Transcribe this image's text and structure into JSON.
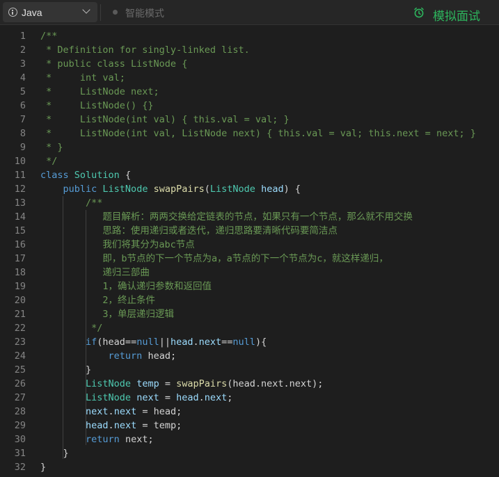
{
  "toolbar": {
    "language": "Java",
    "mode_label": "智能模式",
    "mock_interview_label": "模拟面试",
    "accent_color": "#2db55d"
  },
  "editor": {
    "lines": [
      {
        "n": "1",
        "segs": [
          {
            "t": "/**",
            "c": "cm"
          }
        ]
      },
      {
        "n": "2",
        "segs": [
          {
            "t": " * Definition for singly-linked list.",
            "c": "cm"
          }
        ]
      },
      {
        "n": "3",
        "segs": [
          {
            "t": " * public class ListNode {",
            "c": "cm"
          }
        ]
      },
      {
        "n": "4",
        "segs": [
          {
            "t": " *     int val;",
            "c": "cm"
          }
        ]
      },
      {
        "n": "5",
        "segs": [
          {
            "t": " *     ListNode next;",
            "c": "cm"
          }
        ]
      },
      {
        "n": "6",
        "segs": [
          {
            "t": " *     ListNode() {}",
            "c": "cm"
          }
        ]
      },
      {
        "n": "7",
        "segs": [
          {
            "t": " *     ListNode(int val) { this.val = val; }",
            "c": "cm"
          }
        ]
      },
      {
        "n": "8",
        "segs": [
          {
            "t": " *     ListNode(int val, ListNode next) { this.val = val; this.next = next; }",
            "c": "cm"
          }
        ]
      },
      {
        "n": "9",
        "segs": [
          {
            "t": " * }",
            "c": "cm"
          }
        ]
      },
      {
        "n": "10",
        "segs": [
          {
            "t": " */",
            "c": "cm"
          }
        ]
      },
      {
        "n": "11",
        "segs": [
          {
            "t": "class ",
            "c": "kw"
          },
          {
            "t": "Solution",
            "c": "tp"
          },
          {
            "t": " {",
            "c": "pl"
          }
        ]
      },
      {
        "n": "12",
        "segs": [
          {
            "t": "    ",
            "c": "pl"
          },
          {
            "t": "public ",
            "c": "kw"
          },
          {
            "t": "ListNode",
            "c": "tp"
          },
          {
            "t": " ",
            "c": "pl"
          },
          {
            "t": "swapPairs",
            "c": "fn"
          },
          {
            "t": "(",
            "c": "pl"
          },
          {
            "t": "ListNode",
            "c": "tp"
          },
          {
            "t": " ",
            "c": "pl"
          },
          {
            "t": "head",
            "c": "vr"
          },
          {
            "t": ") {",
            "c": "pl"
          }
        ]
      },
      {
        "n": "13",
        "segs": [
          {
            "t": "        /**",
            "c": "cm"
          }
        ]
      },
      {
        "n": "14",
        "segs": [
          {
            "t": "           题目解析：两两交换给定链表的节点，如果只有一个节点，那么就不用交换",
            "c": "cm"
          }
        ]
      },
      {
        "n": "15",
        "segs": [
          {
            "t": "           思路：使用递归或者迭代，递归思路要清晰代码要简洁点",
            "c": "cm"
          }
        ]
      },
      {
        "n": "16",
        "segs": [
          {
            "t": "           我们将其分为abc节点",
            "c": "cm"
          }
        ]
      },
      {
        "n": "17",
        "segs": [
          {
            "t": "           即，b节点的下一个节点为a，a节点的下一个节点为c，就这样递归，",
            "c": "cm"
          }
        ]
      },
      {
        "n": "18",
        "segs": [
          {
            "t": "           递归三部曲",
            "c": "cm"
          }
        ]
      },
      {
        "n": "19",
        "segs": [
          {
            "t": "           1，确认递归参数和返回值",
            "c": "cm"
          }
        ]
      },
      {
        "n": "20",
        "segs": [
          {
            "t": "           2，终止条件",
            "c": "cm"
          }
        ]
      },
      {
        "n": "21",
        "segs": [
          {
            "t": "           3，单层递归逻辑",
            "c": "cm"
          }
        ]
      },
      {
        "n": "22",
        "segs": [
          {
            "t": "         */",
            "c": "cm"
          }
        ]
      },
      {
        "n": "23",
        "segs": [
          {
            "t": "        ",
            "c": "pl"
          },
          {
            "t": "if",
            "c": "kw"
          },
          {
            "t": "(head==",
            "c": "pl"
          },
          {
            "t": "null",
            "c": "kw"
          },
          {
            "t": "||",
            "c": "pl"
          },
          {
            "t": "head",
            "c": "vr"
          },
          {
            "t": ".",
            "c": "pl"
          },
          {
            "t": "next",
            "c": "vr"
          },
          {
            "t": "==",
            "c": "pl"
          },
          {
            "t": "null",
            "c": "kw"
          },
          {
            "t": "){",
            "c": "pl"
          }
        ]
      },
      {
        "n": "24",
        "segs": [
          {
            "t": "            ",
            "c": "pl"
          },
          {
            "t": "return",
            "c": "kw"
          },
          {
            "t": " head;",
            "c": "pl"
          }
        ]
      },
      {
        "n": "25",
        "segs": [
          {
            "t": "        }",
            "c": "pl"
          }
        ]
      },
      {
        "n": "26",
        "segs": [
          {
            "t": "        ",
            "c": "pl"
          },
          {
            "t": "ListNode",
            "c": "tp"
          },
          {
            "t": " ",
            "c": "pl"
          },
          {
            "t": "temp",
            "c": "vr"
          },
          {
            "t": " = ",
            "c": "pl"
          },
          {
            "t": "swapPairs",
            "c": "fn"
          },
          {
            "t": "(head.next.next);",
            "c": "pl"
          }
        ]
      },
      {
        "n": "27",
        "segs": [
          {
            "t": "        ",
            "c": "pl"
          },
          {
            "t": "ListNode",
            "c": "tp"
          },
          {
            "t": " ",
            "c": "pl"
          },
          {
            "t": "next",
            "c": "vr"
          },
          {
            "t": " = ",
            "c": "pl"
          },
          {
            "t": "head",
            "c": "vr"
          },
          {
            "t": ".",
            "c": "pl"
          },
          {
            "t": "next",
            "c": "vr"
          },
          {
            "t": ";",
            "c": "pl"
          }
        ]
      },
      {
        "n": "28",
        "segs": [
          {
            "t": "        ",
            "c": "pl"
          },
          {
            "t": "next",
            "c": "vr"
          },
          {
            "t": ".",
            "c": "pl"
          },
          {
            "t": "next",
            "c": "vr"
          },
          {
            "t": " = head;",
            "c": "pl"
          }
        ]
      },
      {
        "n": "29",
        "segs": [
          {
            "t": "        ",
            "c": "pl"
          },
          {
            "t": "head",
            "c": "vr"
          },
          {
            "t": ".",
            "c": "pl"
          },
          {
            "t": "next",
            "c": "vr"
          },
          {
            "t": " = temp;",
            "c": "pl"
          }
        ]
      },
      {
        "n": "30",
        "segs": [
          {
            "t": "        ",
            "c": "pl"
          },
          {
            "t": "return",
            "c": "kw"
          },
          {
            "t": " next;",
            "c": "pl"
          }
        ]
      },
      {
        "n": "31",
        "segs": [
          {
            "t": "    }",
            "c": "pl"
          }
        ]
      },
      {
        "n": "32",
        "segs": [
          {
            "t": "}",
            "c": "pl"
          }
        ]
      }
    ]
  }
}
